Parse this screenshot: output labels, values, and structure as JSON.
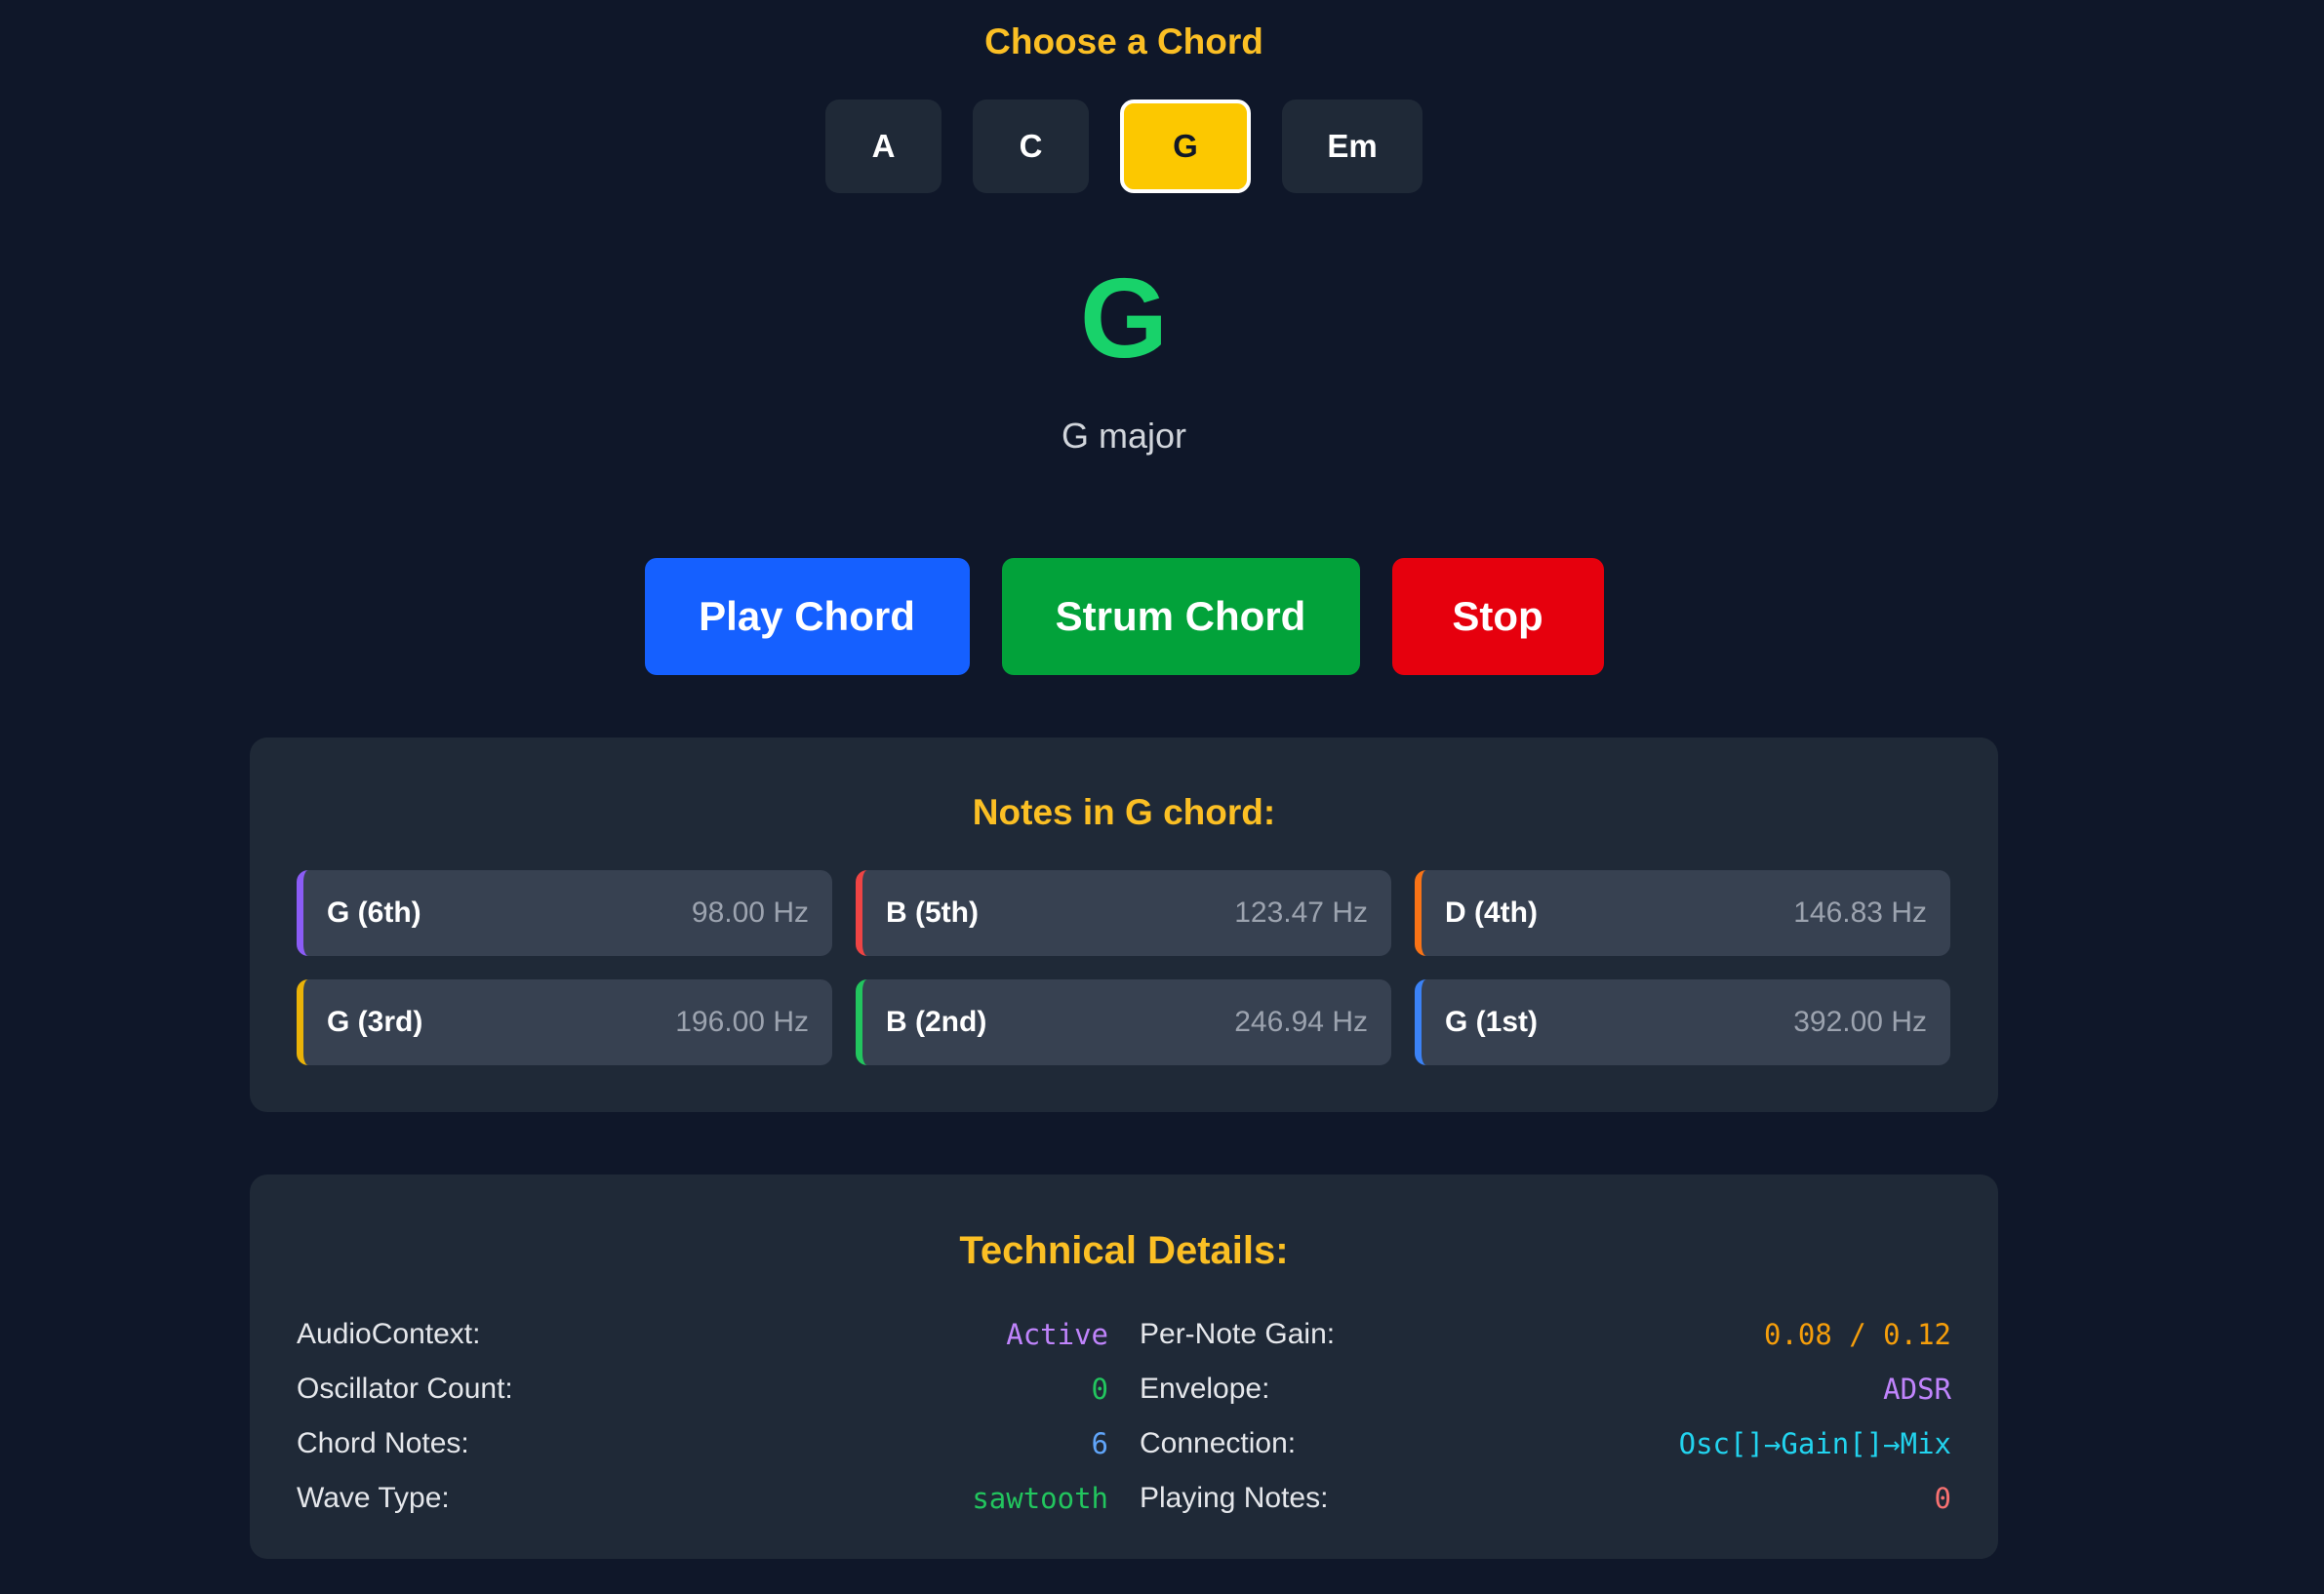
{
  "chooser": {
    "title": "Choose a Chord",
    "chords": [
      {
        "label": "A",
        "active": false
      },
      {
        "label": "C",
        "active": false
      },
      {
        "label": "G",
        "active": true
      },
      {
        "label": "Em",
        "active": false
      }
    ]
  },
  "current": {
    "symbol": "G",
    "description": "G major"
  },
  "actions": {
    "play_label": "Play Chord",
    "strum_label": "Strum Chord",
    "stop_label": "Stop"
  },
  "notes_panel": {
    "title": "Notes in G chord:",
    "notes": [
      {
        "name": "G (6th)",
        "freq": "98.00 Hz",
        "color": "#8b5cf6"
      },
      {
        "name": "B (5th)",
        "freq": "123.47 Hz",
        "color": "#ef4444"
      },
      {
        "name": "D (4th)",
        "freq": "146.83 Hz",
        "color": "#f97316"
      },
      {
        "name": "G (3rd)",
        "freq": "196.00 Hz",
        "color": "#eab308"
      },
      {
        "name": "B (2nd)",
        "freq": "246.94 Hz",
        "color": "#22c55e"
      },
      {
        "name": "G (1st)",
        "freq": "392.00 Hz",
        "color": "#3b82f6"
      }
    ]
  },
  "tech_panel": {
    "title": "Technical Details:",
    "rows": [
      {
        "label": "AudioContext:",
        "value": "Active",
        "color": "#c084fc"
      },
      {
        "label": "Per-Note Gain:",
        "value": "0.08 / 0.12",
        "color": "#f59e0b"
      },
      {
        "label": "Oscillator Count:",
        "value": "0",
        "color": "#22c55e"
      },
      {
        "label": "Envelope:",
        "value": "ADSR",
        "color": "#c084fc"
      },
      {
        "label": "Chord Notes:",
        "value": "6",
        "color": "#60a5fa"
      },
      {
        "label": "Connection:",
        "value": "Osc[]→Gain[]→Mix",
        "color": "#22d3ee"
      },
      {
        "label": "Wave Type:",
        "value": "sawtooth",
        "color": "#22c55e"
      },
      {
        "label": "Playing Notes:",
        "value": "0",
        "color": "#f87171"
      }
    ]
  },
  "colors": {
    "background": "#0f1729",
    "panel": "#1f2937",
    "accent": "#fbbf24",
    "chord_symbol": "#18d26a",
    "play": "#1560ff",
    "strum": "#02a23a",
    "stop": "#e6000d"
  }
}
